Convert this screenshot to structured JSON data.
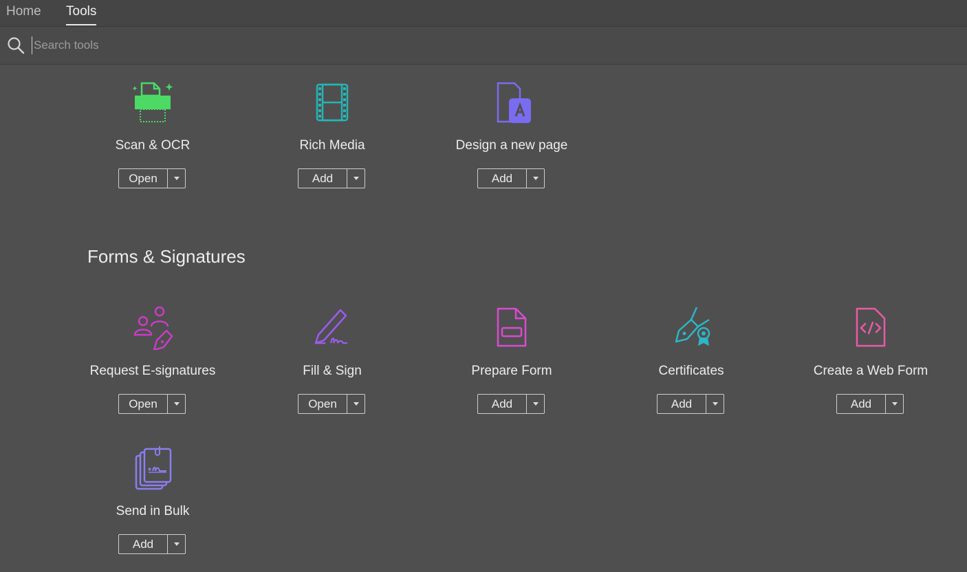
{
  "tabs": {
    "home": "Home",
    "tools": "Tools"
  },
  "search": {
    "placeholder": "Search tools"
  },
  "top_tools": [
    {
      "label": "Scan & OCR",
      "action": "Open",
      "icon": "scan-ocr-icon",
      "color": "#4cd964"
    },
    {
      "label": "Rich Media",
      "action": "Add",
      "icon": "rich-media-icon",
      "color": "#27b5b5"
    },
    {
      "label": "Design a new page",
      "action": "Add",
      "icon": "design-page-icon",
      "color": "#7a6cf0"
    }
  ],
  "section": {
    "title": "Forms & Signatures"
  },
  "form_tools": [
    {
      "label": "Request E-signatures",
      "action": "Open",
      "icon": "request-esignatures-icon",
      "color": "#c93dc4"
    },
    {
      "label": "Fill & Sign",
      "action": "Open",
      "icon": "fill-sign-icon",
      "color": "#9b5cf0"
    },
    {
      "label": "Prepare Form",
      "action": "Add",
      "icon": "prepare-form-icon",
      "color": "#d94bd1"
    },
    {
      "label": "Certificates",
      "action": "Add",
      "icon": "certificates-icon",
      "color": "#2cb6c6"
    },
    {
      "label": "Create a Web Form",
      "action": "Add",
      "icon": "web-form-icon",
      "color": "#ea5aa8"
    },
    {
      "label": "Send in Bulk",
      "action": "Add",
      "icon": "send-bulk-icon",
      "color": "#8c7df0"
    }
  ]
}
